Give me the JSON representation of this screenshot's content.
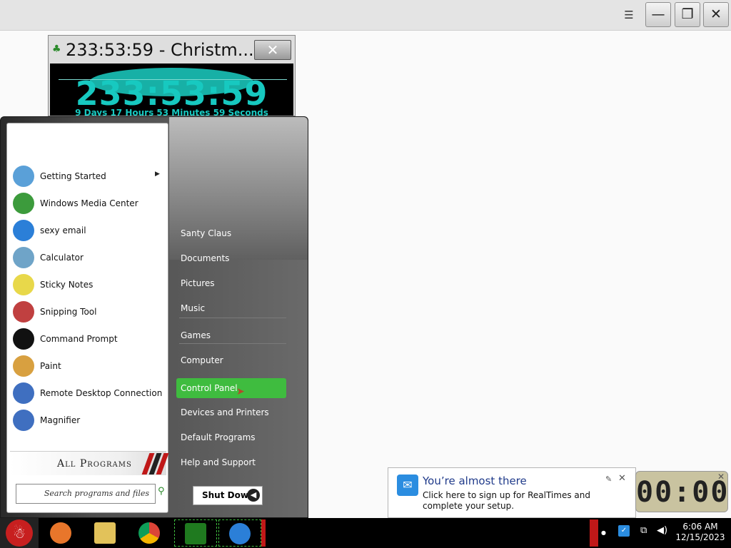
{
  "topbar": {
    "menu_icon": "hamburger-icon",
    "buttons": [
      "minimize-icon",
      "restore-icon",
      "close-icon"
    ]
  },
  "gadget": {
    "title": "233:53:59 - Christm...",
    "big_time": "233:53:59",
    "detail": "9 Days 17 Hours 53 Minutes 59 Seconds",
    "close_glyph": "✕"
  },
  "startmenu": {
    "programs": [
      {
        "label": "Getting Started",
        "icon": "getting-started-icon",
        "submenu": true,
        "color": "#5aa0d8"
      },
      {
        "label": "Windows Media Center",
        "icon": "media-center-icon",
        "submenu": false,
        "color": "#3c9b3c"
      },
      {
        "label": "sexy email",
        "icon": "email-icon",
        "submenu": false,
        "color": "#2b7fd8"
      },
      {
        "label": "Calculator",
        "icon": "calculator-icon",
        "submenu": false,
        "color": "#6fa4c8"
      },
      {
        "label": "Sticky Notes",
        "icon": "sticky-notes-icon",
        "submenu": false,
        "color": "#e8d84a"
      },
      {
        "label": "Snipping Tool",
        "icon": "snipping-tool-icon",
        "submenu": false,
        "color": "#c04040"
      },
      {
        "label": "Command Prompt",
        "icon": "command-prompt-icon",
        "submenu": false,
        "color": "#111111"
      },
      {
        "label": "Paint",
        "icon": "paint-icon",
        "submenu": false,
        "color": "#d8a040"
      },
      {
        "label": "Remote Desktop Connection",
        "icon": "remote-desktop-icon",
        "submenu": false,
        "color": "#3f6fc0"
      },
      {
        "label": "Magnifier",
        "icon": "magnifier-icon",
        "submenu": false,
        "color": "#3f6fc0"
      }
    ],
    "all_programs": "All Programs",
    "search_placeholder": "Search programs and files",
    "right_links": [
      {
        "label": "Santy Claus",
        "active": false
      },
      {
        "label": "Documents",
        "active": false
      },
      {
        "label": "Pictures",
        "active": false
      },
      {
        "label": "Music",
        "active": false
      },
      {
        "label": "Games",
        "active": false
      },
      {
        "label": "Computer",
        "active": false
      },
      {
        "label": "Control Panel",
        "active": true
      },
      {
        "label": "Devices and Printers",
        "active": false
      },
      {
        "label": "Default Programs",
        "active": false
      },
      {
        "label": "Help and Support",
        "active": false
      }
    ],
    "shutdown": "Shut Down",
    "highlight_color": "#3fbc3f"
  },
  "balloon": {
    "title": "You’re almost there",
    "body": "Click here to sign up for RealTimes and complete your setup."
  },
  "clock_gadget": {
    "digits": "00:00"
  },
  "taskbar": {
    "apps": [
      "firefox-icon",
      "explorer-icon",
      "chrome-icon",
      "christmas-tree-icon",
      "email-icon"
    ],
    "time": "6:06 AM",
    "date": "12/15/2023"
  }
}
